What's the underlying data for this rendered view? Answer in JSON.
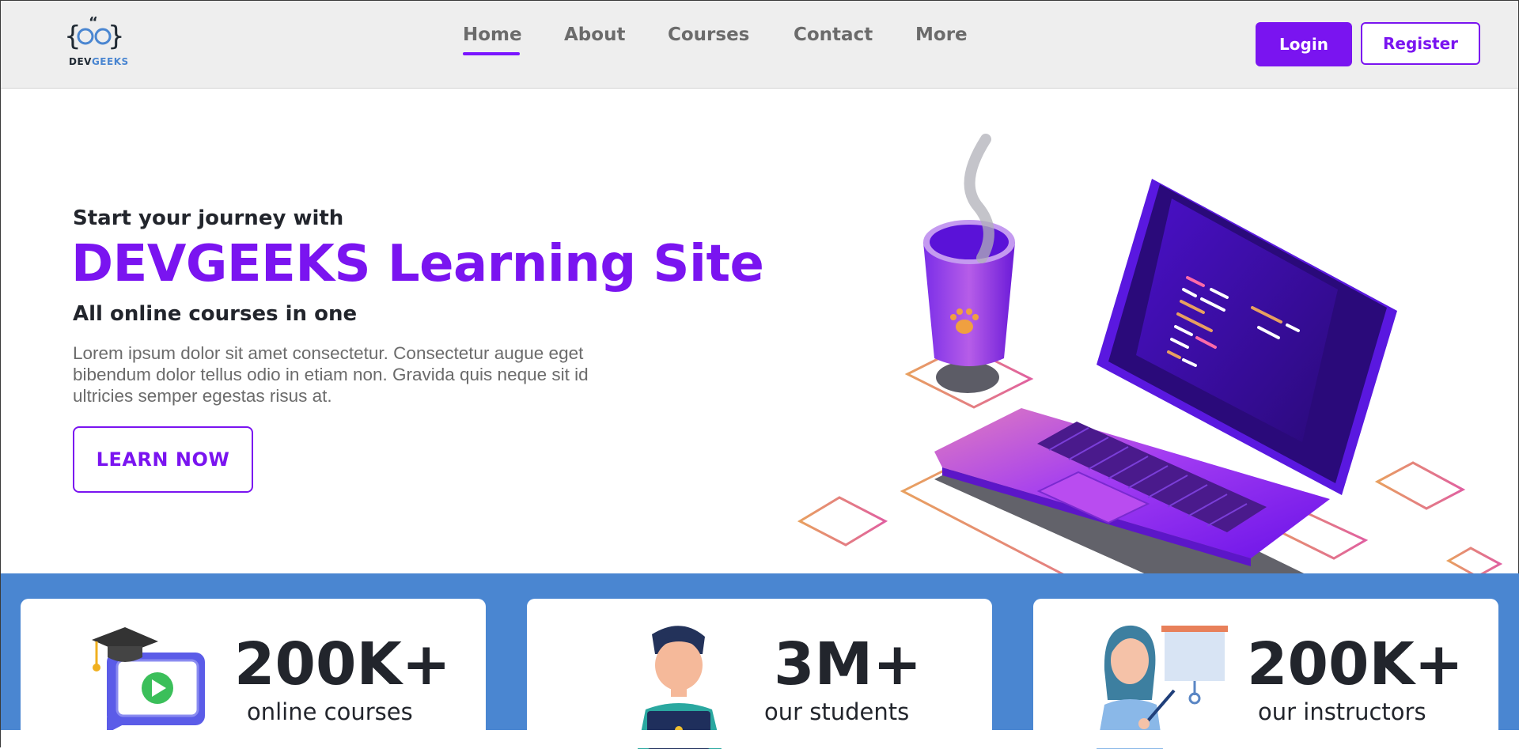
{
  "brand": {
    "logo_dev": "DEV",
    "logo_geeks": "GEEKS"
  },
  "nav": {
    "items": [
      {
        "label": "Home",
        "active": true
      },
      {
        "label": "About"
      },
      {
        "label": "Courses"
      },
      {
        "label": "Contact"
      },
      {
        "label": "More"
      }
    ]
  },
  "auth": {
    "login_label": "Login",
    "register_label": "Register"
  },
  "hero": {
    "eyebrow": "Start your journey with",
    "title": "DEVGEEKS Learning Site",
    "subtitle": "All online courses in one",
    "description": "Lorem ipsum dolor sit amet consectetur. Consectetur augue eget bibendum dolor tellus odio in etiam non. Gravida quis neque sit id ultricies semper egestas risus at.",
    "cta_label": "LEARN NOW"
  },
  "stats": [
    {
      "value": "200K+",
      "label": "online courses",
      "icon": "video-course-icon"
    },
    {
      "value": "3M+",
      "label": "our students",
      "icon": "student-icon"
    },
    {
      "value": "200K+",
      "label": "our instructors",
      "icon": "instructor-icon"
    }
  ],
  "colors": {
    "accent": "#7a14f0",
    "band": "#4a86d1",
    "text_dark": "#22252c",
    "text_muted": "#6b6b6b",
    "nav_bg": "#eeeeee"
  }
}
